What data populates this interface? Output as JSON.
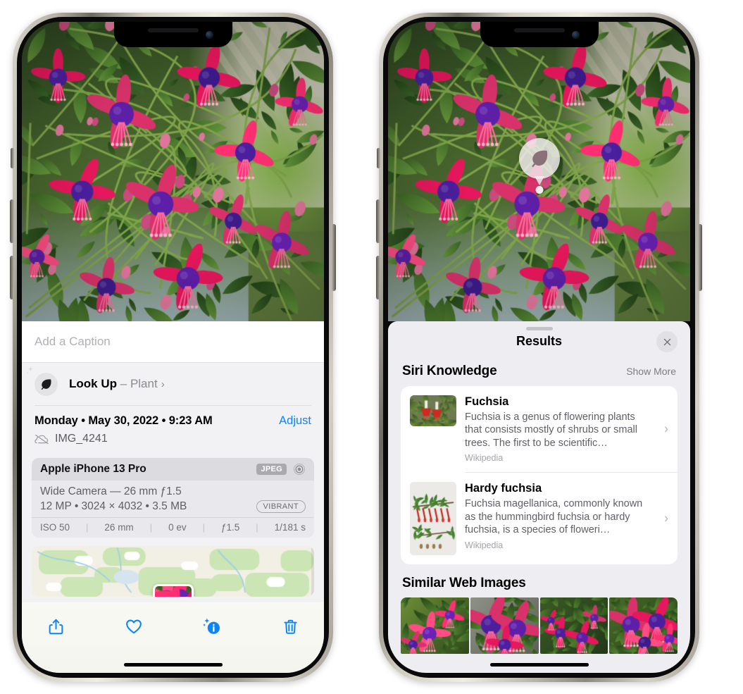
{
  "left_phone": {
    "caption": {
      "placeholder": "Add a Caption",
      "value": ""
    },
    "lookup": {
      "label": "Look Up",
      "dash": "–",
      "subject": "Plant",
      "chevron": "›",
      "icon": "leaf-icon"
    },
    "meta": {
      "date_line": "Monday • May 30, 2022 • 9:23 AM",
      "adjust_label": "Adjust",
      "filename": "IMG_4241",
      "cloud_icon": "icloud-slash-icon"
    },
    "exif": {
      "device": "Apple iPhone 13 Pro",
      "format_badge": "JPEG",
      "aperture_icon": "aperture-icon",
      "lens_line": "Wide Camera — 26 mm ƒ1.5",
      "size_line": "12 MP • 3024 × 4032 • 3.5 MB",
      "style_badge": "VIBRANT",
      "stats": [
        "ISO 50",
        "26 mm",
        "0 ev",
        "ƒ1.5",
        "1/181 s"
      ]
    },
    "toolbar": [
      {
        "name": "share-button",
        "icon": "share-icon"
      },
      {
        "name": "favorite-button",
        "icon": "heart-icon"
      },
      {
        "name": "info-button",
        "icon": "info-sparkle-icon"
      },
      {
        "name": "delete-button",
        "icon": "trash-icon"
      }
    ]
  },
  "right_phone": {
    "marker": {
      "icon": "leaf-icon"
    },
    "sheet_title": "Results",
    "close_icon": "close-icon",
    "siri": {
      "title": "Siri Knowledge",
      "show_more": "Show More",
      "items": [
        {
          "title": "Fuchsia",
          "description": "Fuchsia is a genus of flowering plants that consists mostly of shrubs or small trees. The first to be scientific…",
          "source": "Wikipedia",
          "chevron": "›"
        },
        {
          "title": "Hardy fuchsia",
          "description": "Fuchsia magellanica, commonly known as the hummingbird fuchsia or hardy fuchsia, is a species of floweri…",
          "source": "Wikipedia",
          "chevron": "›"
        }
      ]
    },
    "similar": {
      "title": "Similar Web Images",
      "thumb_count": 4
    }
  },
  "colors": {
    "accent_blue": "#0a84ff",
    "sheet_bg": "#f2f2f5",
    "results_bg": "#eeeef2",
    "card_bg": "#ffffff",
    "secondary_text": "#8a8a8f",
    "badge_gray": "#a9a9ae"
  }
}
